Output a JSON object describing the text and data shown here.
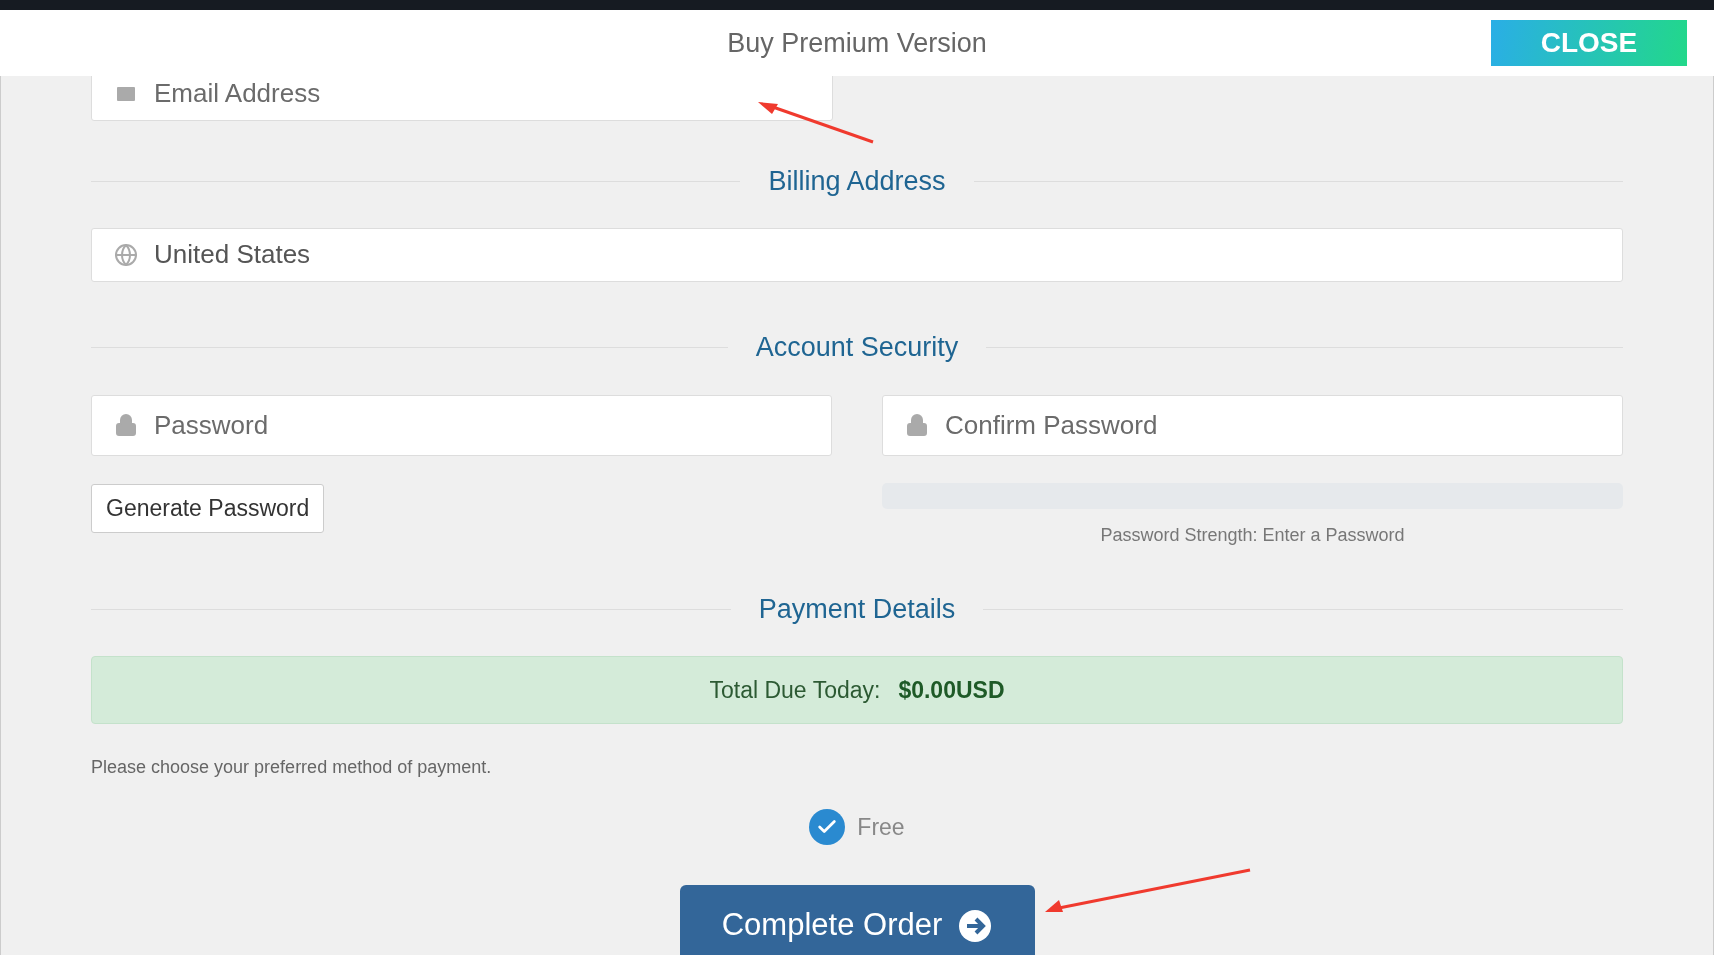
{
  "window": {
    "title": "Buy Premium Version",
    "close_button": "CLOSE"
  },
  "email_field": {
    "placeholder": "Email Address"
  },
  "billing": {
    "title": "Billing Address",
    "country": "United States"
  },
  "security": {
    "title": "Account Security",
    "password": {
      "placeholder": "Password"
    },
    "confirm": {
      "placeholder": "Confirm Password"
    },
    "generate_button": "Generate Password",
    "strength": {
      "level": 0,
      "label": "Password Strength: Enter a Password"
    }
  },
  "payment": {
    "title": "Payment Details",
    "total_label": "Total Due Today:",
    "total_value": "$0.00USD",
    "hint": "Please choose your preferred method of payment.",
    "methods": [
      {
        "label": "Free",
        "selected": true
      }
    ],
    "submit_button": "Complete Order"
  }
}
